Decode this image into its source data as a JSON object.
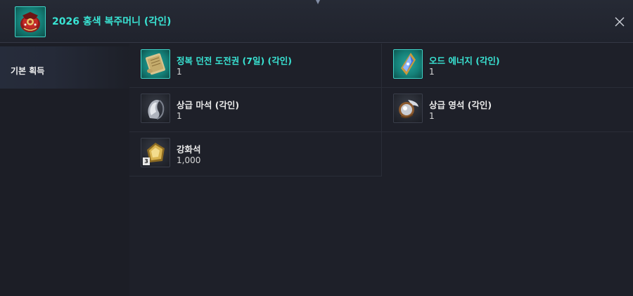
{
  "header": {
    "title": "2026 홍색 복주머니 (각인)",
    "icon": "red-pouch-icon",
    "close_icon": "close-icon"
  },
  "sidebar": {
    "items": [
      {
        "label": "기본 획득",
        "selected": true
      }
    ]
  },
  "items": [
    {
      "name": "정복 던전 도전권 (7일) (각인)",
      "qty": "1",
      "icon": "scroll-icon",
      "rarity_color": "#39e3d3"
    },
    {
      "name": "오드 에너지 (각인)",
      "qty": "1",
      "icon": "blue-crystal-icon",
      "rarity_color": "#39e3d3"
    },
    {
      "name": "상급 마석 (각인)",
      "qty": "1",
      "icon": "silver-stone-icon",
      "rarity_color": "#e8e8e8"
    },
    {
      "name": "상급 영석 (각인)",
      "qty": "1",
      "icon": "winged-orb-icon",
      "rarity_color": "#e8e8e8"
    },
    {
      "name": "강화석",
      "qty": "1,000",
      "icon": "gold-stone-icon",
      "rarity_color": "#e8e8e8",
      "badge": "3"
    }
  ]
}
